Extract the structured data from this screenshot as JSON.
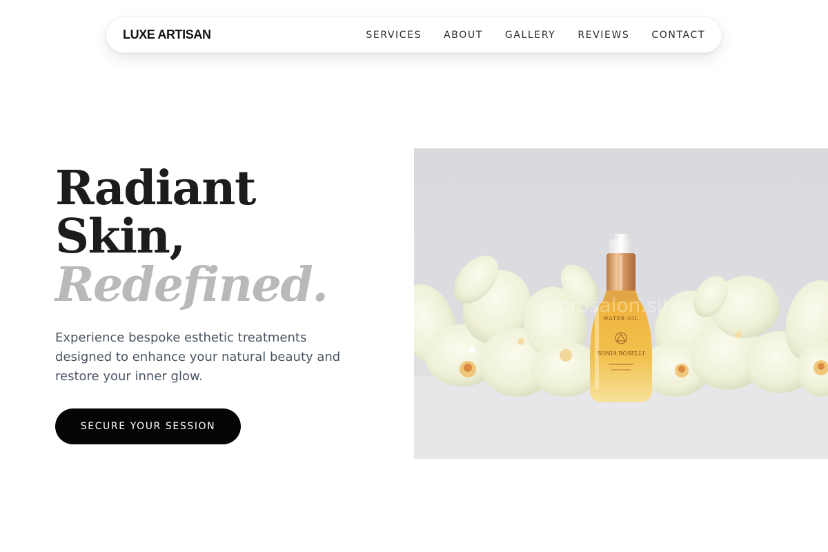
{
  "header": {
    "brand": "LUXE ARTISAN",
    "nav": [
      {
        "label": "SERVICES"
      },
      {
        "label": "ABOUT"
      },
      {
        "label": "GALLERY"
      },
      {
        "label": "REVIEWS"
      },
      {
        "label": "CONTACT"
      }
    ]
  },
  "hero": {
    "title_line1": "Radiant",
    "title_line2": "Skin,",
    "title_accent": "Redefined.",
    "description": "Experience bespoke esthetic treatments designed to enhance your natural beauty and restore your inner glow.",
    "cta_label": "SECURE YOUR SESSION"
  },
  "image": {
    "watermark": "prosalon.site",
    "bottle_label_1": "WATER OIL",
    "bottle_label_2": "SONIA ROSELLI"
  },
  "colors": {
    "accent_text": "#b9b9b9",
    "cta_background": "#050505",
    "body_text": "#4a5563"
  }
}
